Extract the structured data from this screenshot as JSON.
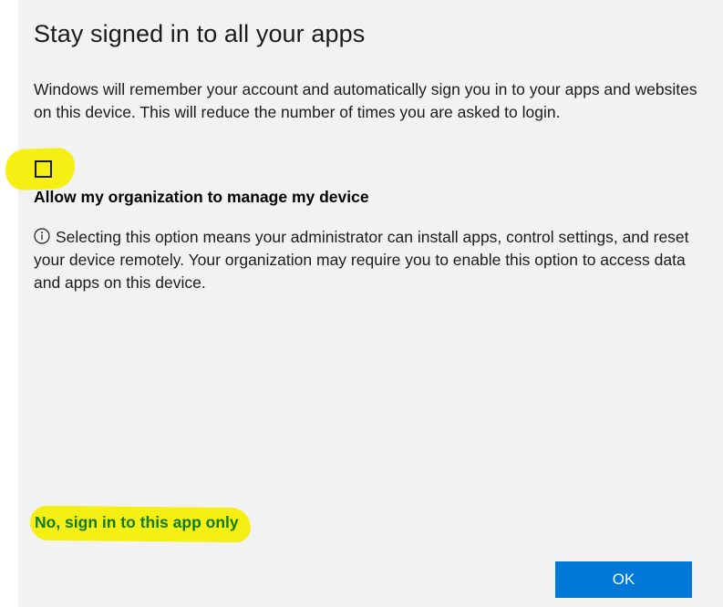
{
  "dialog": {
    "title": "Stay signed in to all your apps",
    "description": "Windows will remember your account and automatically sign you in to your apps and websites on this device. This will reduce the number of times you are asked to login.",
    "checkbox": {
      "checked": false,
      "label": "Allow my organization to manage my device"
    },
    "info_text": "Selecting this option means your administrator can install apps, control settings, and reset your device remotely. Your organization may require you to enable this option to access data and apps on this device.",
    "alt_link": "No, sign in to this app only",
    "ok_label": "OK"
  },
  "colors": {
    "dialog_background": "#f2f2f2",
    "highlight": "#f5ef14",
    "link": "#107c10",
    "button": "#0078d7"
  },
  "icons": {
    "info": "info-circle-icon"
  }
}
